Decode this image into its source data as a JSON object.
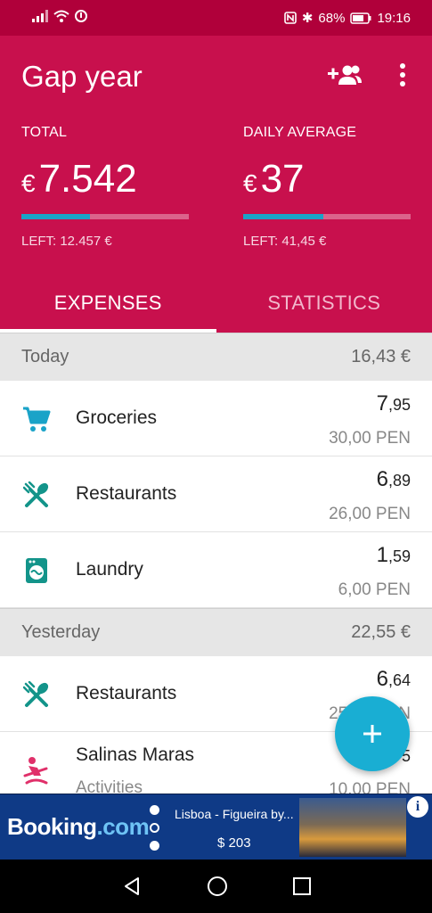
{
  "status_bar": {
    "battery": "68%",
    "time": "19:16"
  },
  "header": {
    "title": "Gap year",
    "add_person_icon": "person-add-icon",
    "menu_icon": "more-vert-icon",
    "total": {
      "label": "TOTAL",
      "currency": "€",
      "value": "7.542",
      "progress": 0.41,
      "left": "LEFT: 12.457 €"
    },
    "daily": {
      "label": "DAILY AVERAGE",
      "currency": "€",
      "value": "37",
      "progress": 0.48,
      "left": "LEFT: 41,45 €"
    }
  },
  "tabs": [
    {
      "label": "EXPENSES",
      "active": true
    },
    {
      "label": "STATISTICS",
      "active": false
    }
  ],
  "sections": [
    {
      "label": "Today",
      "total": "16,43 €",
      "items": [
        {
          "icon": "cart-icon",
          "name": "Groceries",
          "amount_int": "7",
          "amount_dec": ",95",
          "original": "30,00 PEN"
        },
        {
          "icon": "utensils-icon",
          "name": "Restaurants",
          "amount_int": "6",
          "amount_dec": ",89",
          "original": "26,00 PEN"
        },
        {
          "icon": "washing-machine-icon",
          "name": "Laundry",
          "amount_int": "1",
          "amount_dec": ",59",
          "original": "6,00 PEN"
        }
      ]
    },
    {
      "label": "Yesterday",
      "total": "22,55 €",
      "items": [
        {
          "icon": "utensils-icon",
          "name": "Restaurants",
          "amount_int": "6",
          "amount_dec": ",64",
          "original": "25,00 PEN"
        },
        {
          "icon": "activity-icon",
          "name": "Salinas Maras",
          "subtitle": "Activities",
          "amount_int": "",
          "amount_dec": "5",
          "original": "10,00 PEN"
        }
      ]
    }
  ],
  "fab": {
    "icon": "plus-icon"
  },
  "ad": {
    "brand_main": "Booking",
    "brand_suffix": ".com",
    "destination": "Lisboa - Figueira by...",
    "price": "$ 203",
    "info_icon": "info-icon"
  },
  "colors": {
    "primary": "#c8104d",
    "status_bar": "#b0003a",
    "accent": "#19aed3",
    "icon_blue": "#1aa3c8",
    "icon_teal": "#13948a",
    "icon_pink": "#e0306a"
  }
}
